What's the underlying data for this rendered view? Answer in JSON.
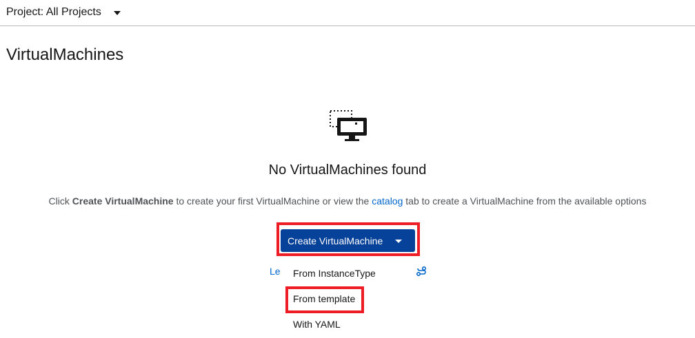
{
  "header": {
    "project_label": "Project: All Projects",
    "project_icon": "caret-down-icon"
  },
  "page": {
    "title": "VirtualMachines"
  },
  "empty_state": {
    "icon": "virtual-machine-icon",
    "title": "No VirtualMachines found",
    "body_prefix": "Click ",
    "body_bold": "Create VirtualMachine",
    "body_middle": " to create your first VirtualMachine or view the ",
    "body_link": "catalog",
    "body_suffix": " tab to create a VirtualMachine from the available options"
  },
  "create_button": {
    "label": "Create VirtualMachine",
    "icon": "caret-down-icon"
  },
  "create_menu": {
    "items": [
      "From InstanceType",
      "From template",
      "With YAML"
    ]
  },
  "background": {
    "partial_link": "Le",
    "partial_icon": "route-icon"
  },
  "colors": {
    "primary_button": "#06419a",
    "link": "#0066cc",
    "highlight": "#ee1c25"
  }
}
